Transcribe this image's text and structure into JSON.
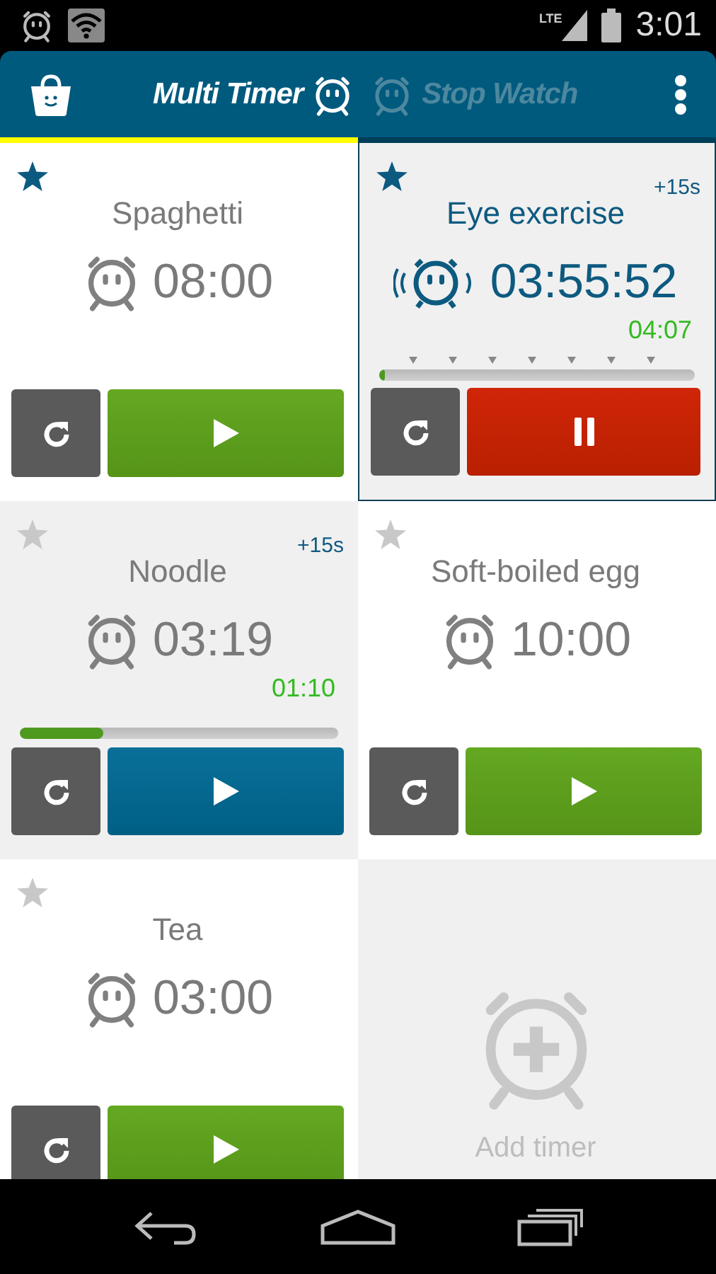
{
  "status_bar": {
    "network": "LTE",
    "time": "3:01"
  },
  "tabs": [
    {
      "label": "Multi Timer",
      "selected": true
    },
    {
      "label": "Stop Watch",
      "selected": false
    }
  ],
  "timers": [
    {
      "name": "Spaghetti",
      "starred": true,
      "time": "08:00",
      "kind": "idle",
      "selected": false
    },
    {
      "name": "Eye exercise",
      "starred": true,
      "time": "03:55:52",
      "elapsed": "04:07",
      "extend": "+15s",
      "kind": "running",
      "level": 0.01,
      "selected": true
    },
    {
      "name": "Noodle",
      "starred": false,
      "time": "03:19",
      "elapsed": "01:10",
      "extend": "+15s",
      "kind": "paused",
      "level": 0.26,
      "selected": false
    },
    {
      "name": "Soft-boiled egg",
      "starred": false,
      "time": "10:00",
      "kind": "idle",
      "selected": false
    },
    {
      "name": "Tea",
      "starred": false,
      "time": "03:00",
      "kind": "idle",
      "selected": false
    }
  ],
  "add_timer": {
    "label": "Add timer"
  }
}
